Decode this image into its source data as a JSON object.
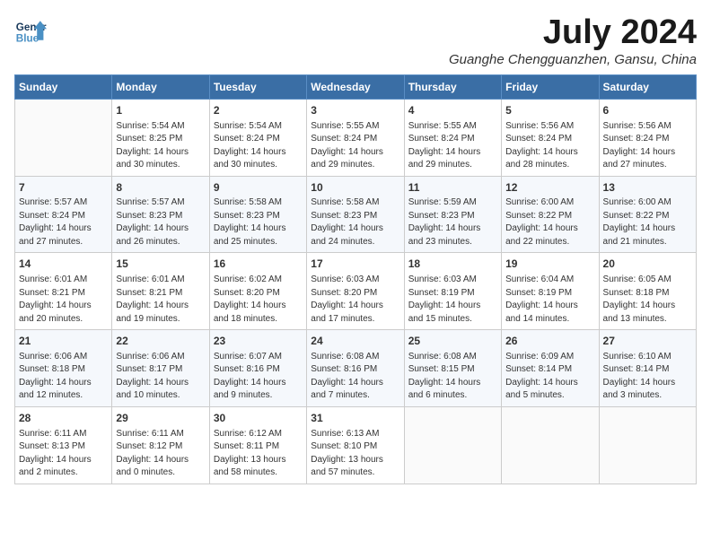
{
  "header": {
    "logo_line1": "General",
    "logo_line2": "Blue",
    "month_title": "July 2024",
    "location": "Guanghe Chengguanzhen, Gansu, China"
  },
  "days_of_week": [
    "Sunday",
    "Monday",
    "Tuesday",
    "Wednesday",
    "Thursday",
    "Friday",
    "Saturday"
  ],
  "weeks": [
    [
      {
        "day": "",
        "info": ""
      },
      {
        "day": "1",
        "info": "Sunrise: 5:54 AM\nSunset: 8:25 PM\nDaylight: 14 hours\nand 30 minutes."
      },
      {
        "day": "2",
        "info": "Sunrise: 5:54 AM\nSunset: 8:24 PM\nDaylight: 14 hours\nand 30 minutes."
      },
      {
        "day": "3",
        "info": "Sunrise: 5:55 AM\nSunset: 8:24 PM\nDaylight: 14 hours\nand 29 minutes."
      },
      {
        "day": "4",
        "info": "Sunrise: 5:55 AM\nSunset: 8:24 PM\nDaylight: 14 hours\nand 29 minutes."
      },
      {
        "day": "5",
        "info": "Sunrise: 5:56 AM\nSunset: 8:24 PM\nDaylight: 14 hours\nand 28 minutes."
      },
      {
        "day": "6",
        "info": "Sunrise: 5:56 AM\nSunset: 8:24 PM\nDaylight: 14 hours\nand 27 minutes."
      }
    ],
    [
      {
        "day": "7",
        "info": "Sunrise: 5:57 AM\nSunset: 8:24 PM\nDaylight: 14 hours\nand 27 minutes."
      },
      {
        "day": "8",
        "info": "Sunrise: 5:57 AM\nSunset: 8:23 PM\nDaylight: 14 hours\nand 26 minutes."
      },
      {
        "day": "9",
        "info": "Sunrise: 5:58 AM\nSunset: 8:23 PM\nDaylight: 14 hours\nand 25 minutes."
      },
      {
        "day": "10",
        "info": "Sunrise: 5:58 AM\nSunset: 8:23 PM\nDaylight: 14 hours\nand 24 minutes."
      },
      {
        "day": "11",
        "info": "Sunrise: 5:59 AM\nSunset: 8:23 PM\nDaylight: 14 hours\nand 23 minutes."
      },
      {
        "day": "12",
        "info": "Sunrise: 6:00 AM\nSunset: 8:22 PM\nDaylight: 14 hours\nand 22 minutes."
      },
      {
        "day": "13",
        "info": "Sunrise: 6:00 AM\nSunset: 8:22 PM\nDaylight: 14 hours\nand 21 minutes."
      }
    ],
    [
      {
        "day": "14",
        "info": "Sunrise: 6:01 AM\nSunset: 8:21 PM\nDaylight: 14 hours\nand 20 minutes."
      },
      {
        "day": "15",
        "info": "Sunrise: 6:01 AM\nSunset: 8:21 PM\nDaylight: 14 hours\nand 19 minutes."
      },
      {
        "day": "16",
        "info": "Sunrise: 6:02 AM\nSunset: 8:20 PM\nDaylight: 14 hours\nand 18 minutes."
      },
      {
        "day": "17",
        "info": "Sunrise: 6:03 AM\nSunset: 8:20 PM\nDaylight: 14 hours\nand 17 minutes."
      },
      {
        "day": "18",
        "info": "Sunrise: 6:03 AM\nSunset: 8:19 PM\nDaylight: 14 hours\nand 15 minutes."
      },
      {
        "day": "19",
        "info": "Sunrise: 6:04 AM\nSunset: 8:19 PM\nDaylight: 14 hours\nand 14 minutes."
      },
      {
        "day": "20",
        "info": "Sunrise: 6:05 AM\nSunset: 8:18 PM\nDaylight: 14 hours\nand 13 minutes."
      }
    ],
    [
      {
        "day": "21",
        "info": "Sunrise: 6:06 AM\nSunset: 8:18 PM\nDaylight: 14 hours\nand 12 minutes."
      },
      {
        "day": "22",
        "info": "Sunrise: 6:06 AM\nSunset: 8:17 PM\nDaylight: 14 hours\nand 10 minutes."
      },
      {
        "day": "23",
        "info": "Sunrise: 6:07 AM\nSunset: 8:16 PM\nDaylight: 14 hours\nand 9 minutes."
      },
      {
        "day": "24",
        "info": "Sunrise: 6:08 AM\nSunset: 8:16 PM\nDaylight: 14 hours\nand 7 minutes."
      },
      {
        "day": "25",
        "info": "Sunrise: 6:08 AM\nSunset: 8:15 PM\nDaylight: 14 hours\nand 6 minutes."
      },
      {
        "day": "26",
        "info": "Sunrise: 6:09 AM\nSunset: 8:14 PM\nDaylight: 14 hours\nand 5 minutes."
      },
      {
        "day": "27",
        "info": "Sunrise: 6:10 AM\nSunset: 8:14 PM\nDaylight: 14 hours\nand 3 minutes."
      }
    ],
    [
      {
        "day": "28",
        "info": "Sunrise: 6:11 AM\nSunset: 8:13 PM\nDaylight: 14 hours\nand 2 minutes."
      },
      {
        "day": "29",
        "info": "Sunrise: 6:11 AM\nSunset: 8:12 PM\nDaylight: 14 hours\nand 0 minutes."
      },
      {
        "day": "30",
        "info": "Sunrise: 6:12 AM\nSunset: 8:11 PM\nDaylight: 13 hours\nand 58 minutes."
      },
      {
        "day": "31",
        "info": "Sunrise: 6:13 AM\nSunset: 8:10 PM\nDaylight: 13 hours\nand 57 minutes."
      },
      {
        "day": "",
        "info": ""
      },
      {
        "day": "",
        "info": ""
      },
      {
        "day": "",
        "info": ""
      }
    ]
  ]
}
